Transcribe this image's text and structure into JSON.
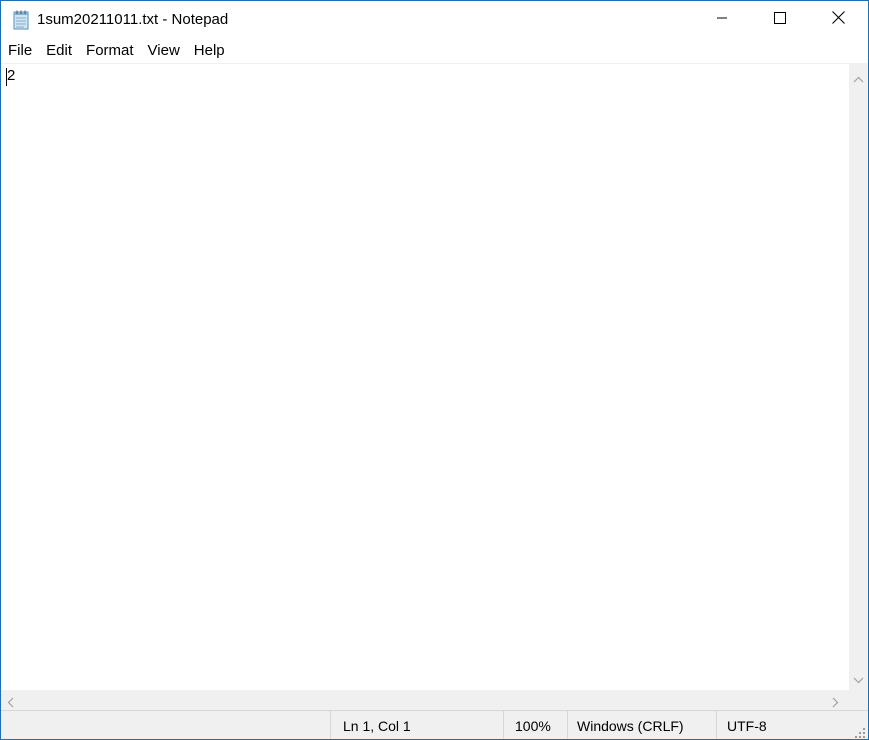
{
  "window": {
    "title": "1sum20211011.txt - Notepad",
    "app_icon": "notepad-icon",
    "accent_border": "#1a6fb5"
  },
  "caption_buttons": {
    "minimize": "minimize-icon",
    "maximize": "maximize-icon",
    "close": "close-icon"
  },
  "menu": {
    "items": [
      "File",
      "Edit",
      "Format",
      "View",
      "Help"
    ]
  },
  "editor": {
    "content": "2"
  },
  "status": {
    "position": "Ln 1, Col 1",
    "zoom": "100%",
    "line_endings": "Windows (CRLF)",
    "encoding": "UTF-8"
  }
}
